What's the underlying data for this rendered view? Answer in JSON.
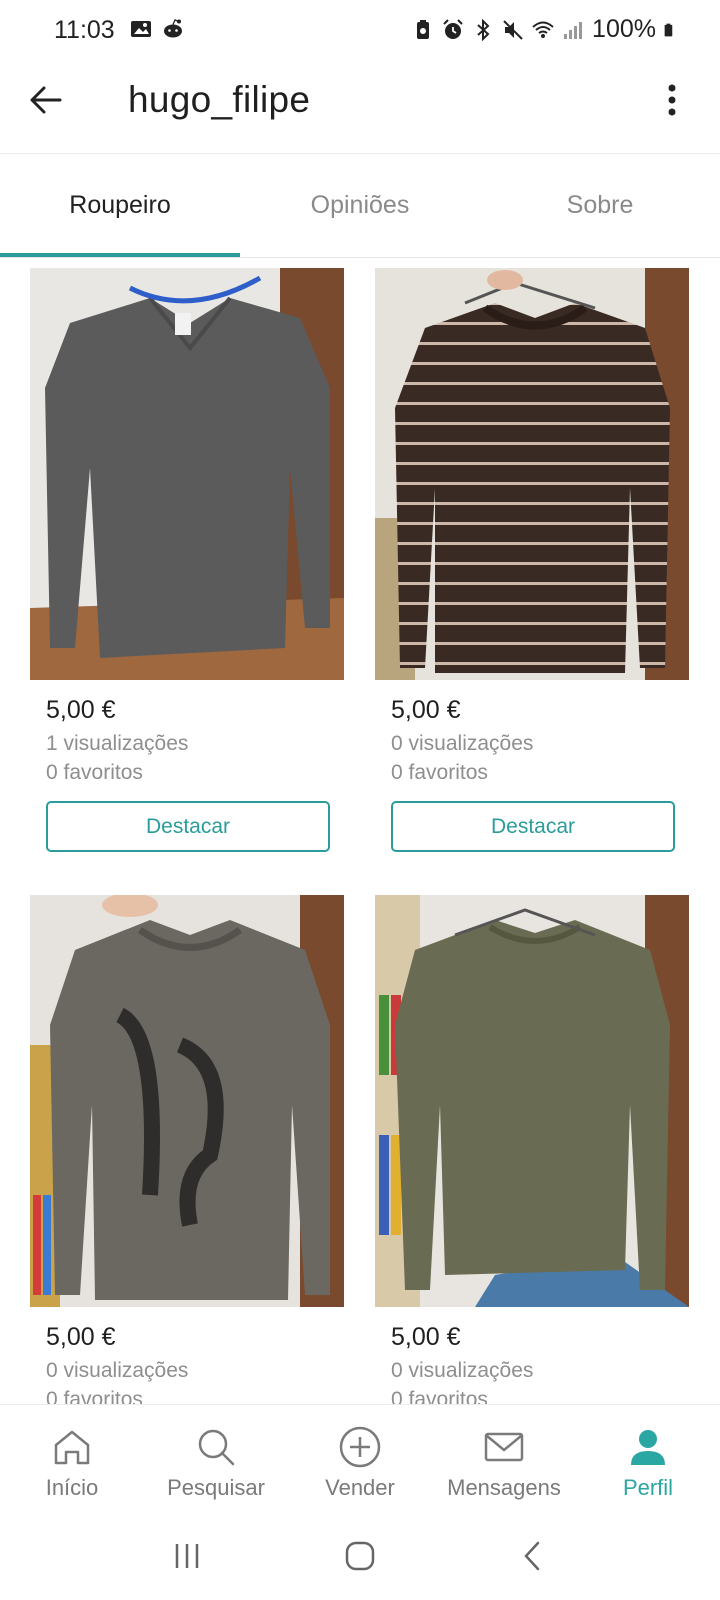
{
  "status_bar": {
    "time": "11:03",
    "battery": "100%"
  },
  "app_bar": {
    "title": "hugo_filipe",
    "back_icon": "arrow-left-icon",
    "menu_icon": "more-vertical-icon"
  },
  "tabs": [
    {
      "label": "Roupeiro",
      "active": true
    },
    {
      "label": "Opiniões",
      "active": false
    },
    {
      "label": "Sobre",
      "active": false
    }
  ],
  "items": [
    {
      "price": "5,00 €",
      "views": "1 visualizações",
      "favorites": "0 favoritos",
      "button": "Destacar"
    },
    {
      "price": "5,00 €",
      "views": "0 visualizações",
      "favorites": "0 favoritos",
      "button": "Destacar"
    },
    {
      "price": "5,00 €",
      "views": "0 visualizações",
      "favorites": "0 favoritos"
    },
    {
      "price": "5,00 €",
      "views": "0 visualizações",
      "favorites": "0 favoritos"
    }
  ],
  "bottom_nav": [
    {
      "label": "Início",
      "icon": "home-icon"
    },
    {
      "label": "Pesquisar",
      "icon": "search-icon"
    },
    {
      "label": "Vender",
      "icon": "plus-circle-icon"
    },
    {
      "label": "Mensagens",
      "icon": "mail-icon"
    },
    {
      "label": "Perfil",
      "icon": "person-icon",
      "active": true
    }
  ],
  "colors": {
    "accent": "#2a9d9a",
    "text": "#1f1f1f",
    "muted": "#8e8e8e"
  }
}
